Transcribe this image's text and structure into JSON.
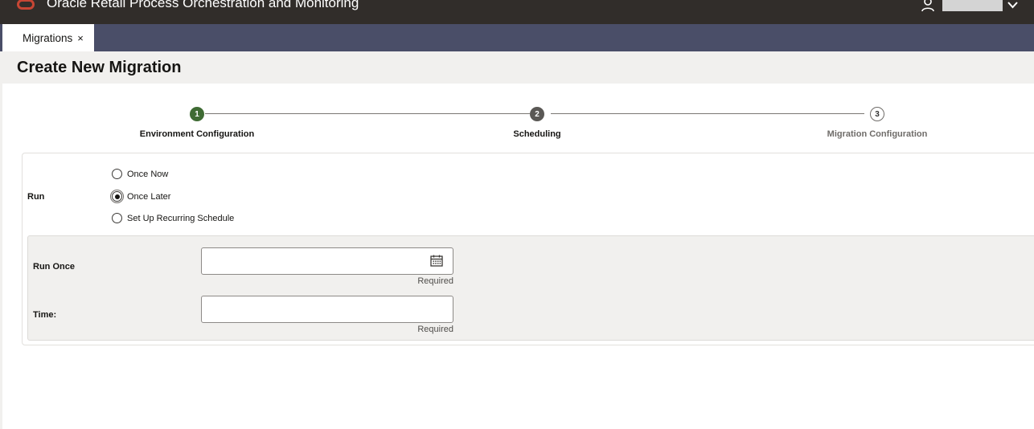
{
  "header": {
    "app_title": "Oracle Retail Process Orchestration and Monitoring",
    "logo_icon": "oracle-logo",
    "user_icon": "person-icon",
    "menu_icon": "chevron-down-icon"
  },
  "tabs": [
    {
      "label": "Migrations",
      "close": "×"
    }
  ],
  "page": {
    "title": "Create New Migration"
  },
  "train": {
    "steps": [
      {
        "number": "1",
        "label": "Environment Configuration",
        "state": "completed"
      },
      {
        "number": "2",
        "label": "Scheduling",
        "state": "current"
      },
      {
        "number": "3",
        "label": "Migration Configuration",
        "state": "not-visited"
      }
    ]
  },
  "form": {
    "run_label": "Run",
    "run_options": [
      {
        "label": "Once Now",
        "checked": false
      },
      {
        "label": "Once Later",
        "checked": true
      },
      {
        "label": "Set Up Recurring Schedule",
        "checked": false
      }
    ],
    "run_once": {
      "label": "Run Once",
      "value": "",
      "hint": "Required",
      "icon": "calendar-icon"
    },
    "time": {
      "label": "Time:",
      "value": "",
      "hint": "Required"
    }
  },
  "colors": {
    "header_bg": "#312d2a",
    "tab_bar_bg": "#4a4e68",
    "logo_red": "#c74634",
    "step_done": "#3f6b34",
    "step_current": "#5a5855",
    "panel_bg": "#f1f0ee"
  }
}
